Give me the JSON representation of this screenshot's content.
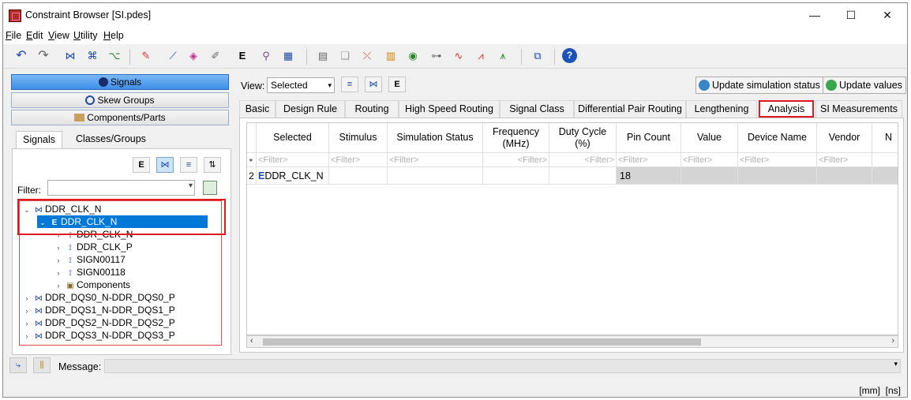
{
  "window": {
    "title": "Constraint Browser [SI.pdes]",
    "controls": {
      "minimize": "—",
      "maximize": "☐",
      "close": "✕"
    }
  },
  "menu": {
    "items": [
      {
        "ul": "F",
        "rest": "ile"
      },
      {
        "ul": "E",
        "rest": "dit"
      },
      {
        "ul": "V",
        "rest": "iew"
      },
      {
        "ul": "U",
        "rest": "tility"
      },
      {
        "ul": "H",
        "rest": "elp"
      }
    ]
  },
  "left": {
    "stack_buttons": {
      "signals": "Signals",
      "skew_groups": "Skew Groups",
      "components": "Components/Parts"
    },
    "tabs": {
      "signals": "Signals",
      "classes": "Classes/Groups"
    },
    "filter_label": "Filter:",
    "filter_value": "",
    "tree": [
      {
        "label": "DDR_CLK_N"
      },
      {
        "label": "DDR_CLK_N"
      },
      {
        "label": "DDR_CLK_N"
      },
      {
        "label": "DDR_CLK_P"
      },
      {
        "label": "SIGN00117"
      },
      {
        "label": "SIGN00118"
      },
      {
        "label": "Components"
      },
      {
        "label": "DDR_DQS0_N-DDR_DQS0_P"
      },
      {
        "label": "DDR_DQS1_N-DDR_DQS1_P"
      },
      {
        "label": "DDR_DQS2_N-DDR_DQS2_P"
      },
      {
        "label": "DDR_DQS3_N-DDR_DQS3_P"
      }
    ]
  },
  "right": {
    "view_label": "View:",
    "view_value": "Selected",
    "update_sim_status": "Update simulation status",
    "update_values": "Update values",
    "tabs": [
      "Basic",
      "Design Rule",
      "Routing",
      "High Speed Routing",
      "Signal Class",
      "Differential Pair Routing",
      "Lengthening",
      "Analysis",
      "SI Measurements"
    ],
    "active_tab": "Analysis",
    "grid": {
      "columns": [
        "Selected",
        "Stimulus",
        "Simulation Status",
        "Frequency\n(MHz)",
        "Duty Cycle\n(%)",
        "Pin Count",
        "Value",
        "Device Name",
        "Vendor",
        "N"
      ],
      "filter_placeholder": "<Filter>",
      "row": {
        "index": "2",
        "selected": "DDR_CLK_N",
        "pin_count": "18"
      }
    }
  },
  "status": {
    "message_label": "Message:",
    "message_value": "",
    "units": "[mm]  [ns]"
  }
}
